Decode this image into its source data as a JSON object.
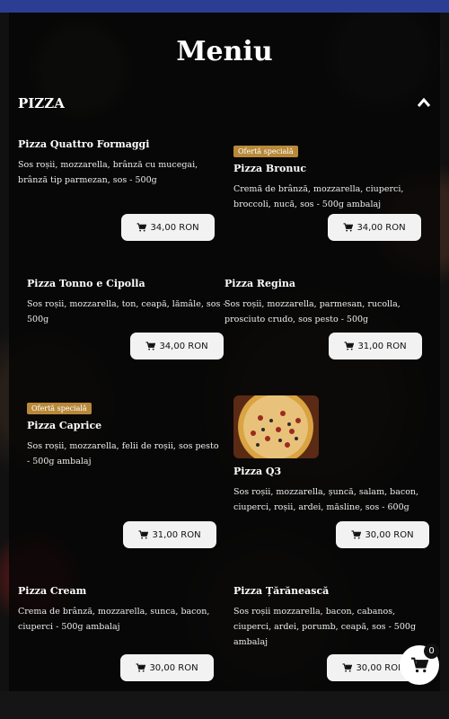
{
  "page": {
    "title": "Meniu"
  },
  "section": {
    "title": "PIZZA"
  },
  "colors": {
    "header_bar": "#2c3d94",
    "badge": "#b8893a",
    "button_bg": "#f2f2f2"
  },
  "items": [
    {
      "name": "Pizza Quattro Formaggi",
      "desc": "Sos roșii, mozzarella, brânză cu mucegai, brânză tip parmezan, sos - 500g",
      "price": "34,00 RON",
      "badge": ""
    },
    {
      "name": "Pizza Bronuc",
      "desc": "Cremă de brânză, mozzarella, ciuperci, broccoli, nucă, sos - 500g ambalaj",
      "price": "34,00 RON",
      "badge": "Ofertă specială"
    },
    {
      "name": "Pizza Tonno e Cipolla",
      "desc": "Sos roșii, mozzarella, ton, ceapă, lămâle, sos - 500g",
      "price": "34,00 RON",
      "badge": ""
    },
    {
      "name": "Pizza Regina",
      "desc": "Sos roșii, mozzarella, parmesan, rucolla, prosciuto crudo, sos pesto - 500g",
      "price": "31,00 RON",
      "badge": ""
    },
    {
      "name": "Pizza Caprice",
      "desc": "Sos roșii, mozzarella, felii de roșii, sos pesto - 500g ambalaj",
      "price": "31,00 RON",
      "badge": "Ofertă specială"
    },
    {
      "name": "Pizza Q3",
      "desc": "Sos roșii, mozzarella, șuncă, salam, bacon, ciuperci, roșii, ardei, măsline, sos - 600g",
      "price": "30,00 RON",
      "badge": ""
    },
    {
      "name": "Pizza Cream",
      "desc": "Crema de brânză, mozzarella, sunca, bacon, ciuperci - 500g ambalaj",
      "price": "30,00 RON",
      "badge": ""
    },
    {
      "name": "Pizza Țărănească",
      "desc": "Sos roșii mozzarella, bacon, cabanos, ciuperci, ardei, porumb, ceapă, sos - 500g ambalaj",
      "price": "30,00 RON",
      "badge": ""
    }
  ],
  "cart": {
    "count": "0",
    "icon": "cart-icon"
  }
}
